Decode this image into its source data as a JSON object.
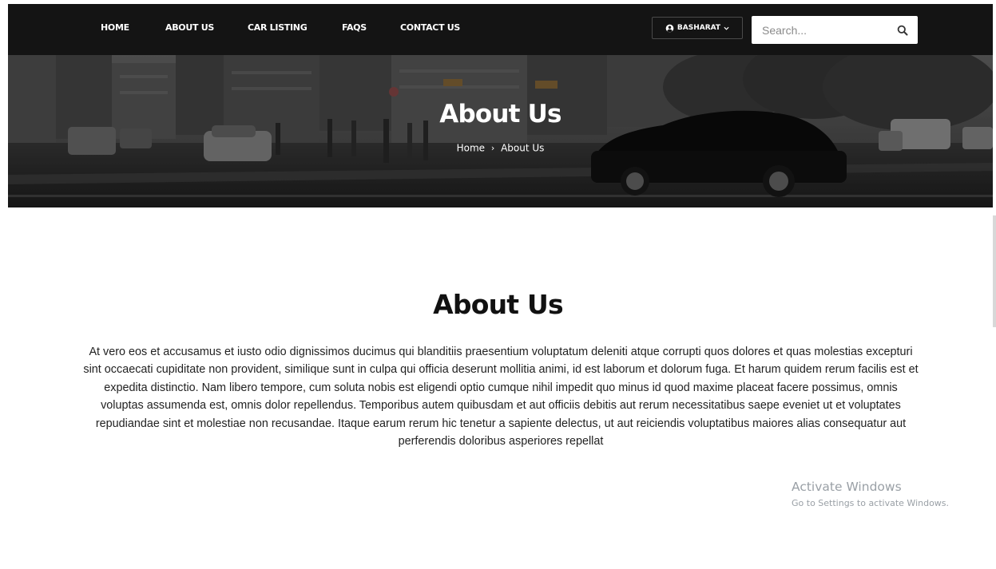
{
  "nav": {
    "items": [
      {
        "label": "HOME"
      },
      {
        "label": "ABOUT US"
      },
      {
        "label": "CAR LISTING"
      },
      {
        "label": "FAQS"
      },
      {
        "label": "CONTACT US"
      }
    ],
    "user_label": "BASHARAT",
    "user_icon": "user-circle-icon",
    "caret_icon": "chevron-down-icon",
    "search_placeholder": "Search...",
    "search_icon": "search-icon"
  },
  "hero": {
    "title": "About Us",
    "breadcrumb": {
      "home": "Home",
      "separator": "›",
      "current": "About Us"
    }
  },
  "content": {
    "heading": "About Us",
    "body": "At vero eos et accusamus et iusto odio dignissimos ducimus qui blanditiis praesentium voluptatum deleniti atque corrupti quos dolores et quas molestias excepturi sint occaecati cupiditate non provident, similique sunt in culpa qui officia deserunt mollitia animi, id est laborum et dolorum fuga. Et harum quidem rerum facilis est et expedita distinctio. Nam libero tempore, cum soluta nobis est eligendi optio cumque nihil impedit quo minus id quod maxime placeat facere possimus, omnis voluptas assumenda est, omnis dolor repellendus. Temporibus autem quibusdam et aut officiis debitis aut rerum necessitatibus saepe eveniet ut et voluptates repudiandae sint et molestiae non recusandae. Itaque earum rerum hic tenetur a sapiente delectus, ut aut reiciendis voluptatibus maiores alias consequatur aut perferendis doloribus asperiores repellat"
  },
  "watermark": {
    "title": "Activate Windows",
    "subtitle": "Go to Settings to activate Windows."
  },
  "colors": {
    "navbar_bg": "#141414",
    "text_dark": "#111111",
    "watermark": "#9aa0a6"
  }
}
